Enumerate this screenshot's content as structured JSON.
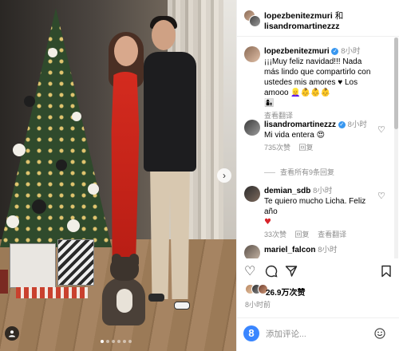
{
  "header": {
    "user1": "lopezbenitezmuri",
    "joiner": "和",
    "user2": "lisandromartinezzz"
  },
  "comments": [
    {
      "username": "lopezbenitezmuri",
      "verified": true,
      "time": "8小时",
      "text": "¡¡¡Muy feliz navidad!!! Nada más lindo que compartirlo con ustedes mis amores ♥ Los amooo",
      "emojis": "👱‍♀️👶👶👶",
      "extra_emoji": "👩‍👦",
      "translate": "查看翻译"
    },
    {
      "username": "lisandromartinezzz",
      "verified": true,
      "time": "8小时",
      "text": "Mi vida entera",
      "emoji": "😍",
      "likes": "735次赞",
      "reply": "回复",
      "view_replies": "查看所有9条回复"
    },
    {
      "username": "demian_sdb",
      "verified": false,
      "time": "8小时",
      "text": "Te quiero mucho Licha. Feliz año",
      "emoji": "♥",
      "likes": "33次赞",
      "reply": "回复",
      "translate": "查看翻译"
    },
    {
      "username": "mariel_falcon",
      "verified": false,
      "time": "8小时"
    }
  ],
  "actions": {
    "like_icon": "heart-outline-icon",
    "comment_icon": "comment-icon",
    "share_icon": "send-icon",
    "save_icon": "bookmark-icon"
  },
  "likes": {
    "count": "26.9万次赞"
  },
  "posted_ago": "8小时前",
  "compose": {
    "placeholder": "添加评论...",
    "logo": "8"
  },
  "colors": {
    "verified": "#3897f0",
    "dress": "#d42b1f",
    "link": "#8e8e8e"
  }
}
